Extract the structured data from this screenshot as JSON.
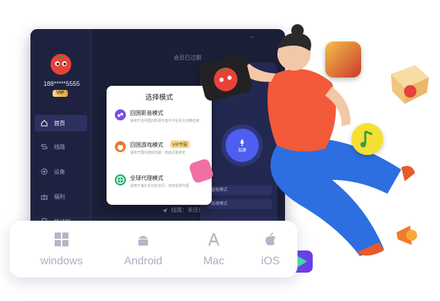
{
  "app": {
    "phone": "188*****5555",
    "vip_badge": "VIP",
    "member_tip": "会员已过期",
    "nav": [
      {
        "label": "首页",
        "icon": "home-icon"
      },
      {
        "label": "线路",
        "icon": "route-icon"
      },
      {
        "label": "设备",
        "icon": "device-icon"
      },
      {
        "label": "福利",
        "icon": "gift-icon"
      },
      {
        "label": "移动端",
        "icon": "mobile-icon"
      }
    ],
    "status": "线路：未连接"
  },
  "dialog": {
    "title": "选择模式",
    "modes": [
      {
        "title": "回国影音模式",
        "desc": "适用于访问国内影视与音乐平台及大流量应用",
        "icon": "music-mode-icon",
        "color": "#7b4de8"
      },
      {
        "title": "回国游戏模式",
        "desc": "适用于国内游戏加速，低延迟更稳定",
        "tag": "VIP专属",
        "icon": "game-mode-icon",
        "color": "#f07a2a"
      },
      {
        "title": "全球代理模式",
        "desc": "适用于海外多元化访问，支持全局代理",
        "icon": "global-mode-icon",
        "color": "#1fae6a"
      }
    ]
  },
  "panel": {
    "accelerate": "加速",
    "rows": [
      "智能模式",
      "加速模式"
    ]
  },
  "platforms": [
    {
      "label": "windows",
      "icon": "windows-icon"
    },
    {
      "label": "Android",
      "icon": "android-icon"
    },
    {
      "label": "Mac",
      "icon": "mac-icon"
    },
    {
      "label": "iOS",
      "icon": "apple-icon"
    }
  ],
  "colors": {
    "app_bg": "#1b1f37",
    "accent": "#4e5ef0",
    "tomato": "#e8413a",
    "vip_gold": "#d9a741"
  }
}
